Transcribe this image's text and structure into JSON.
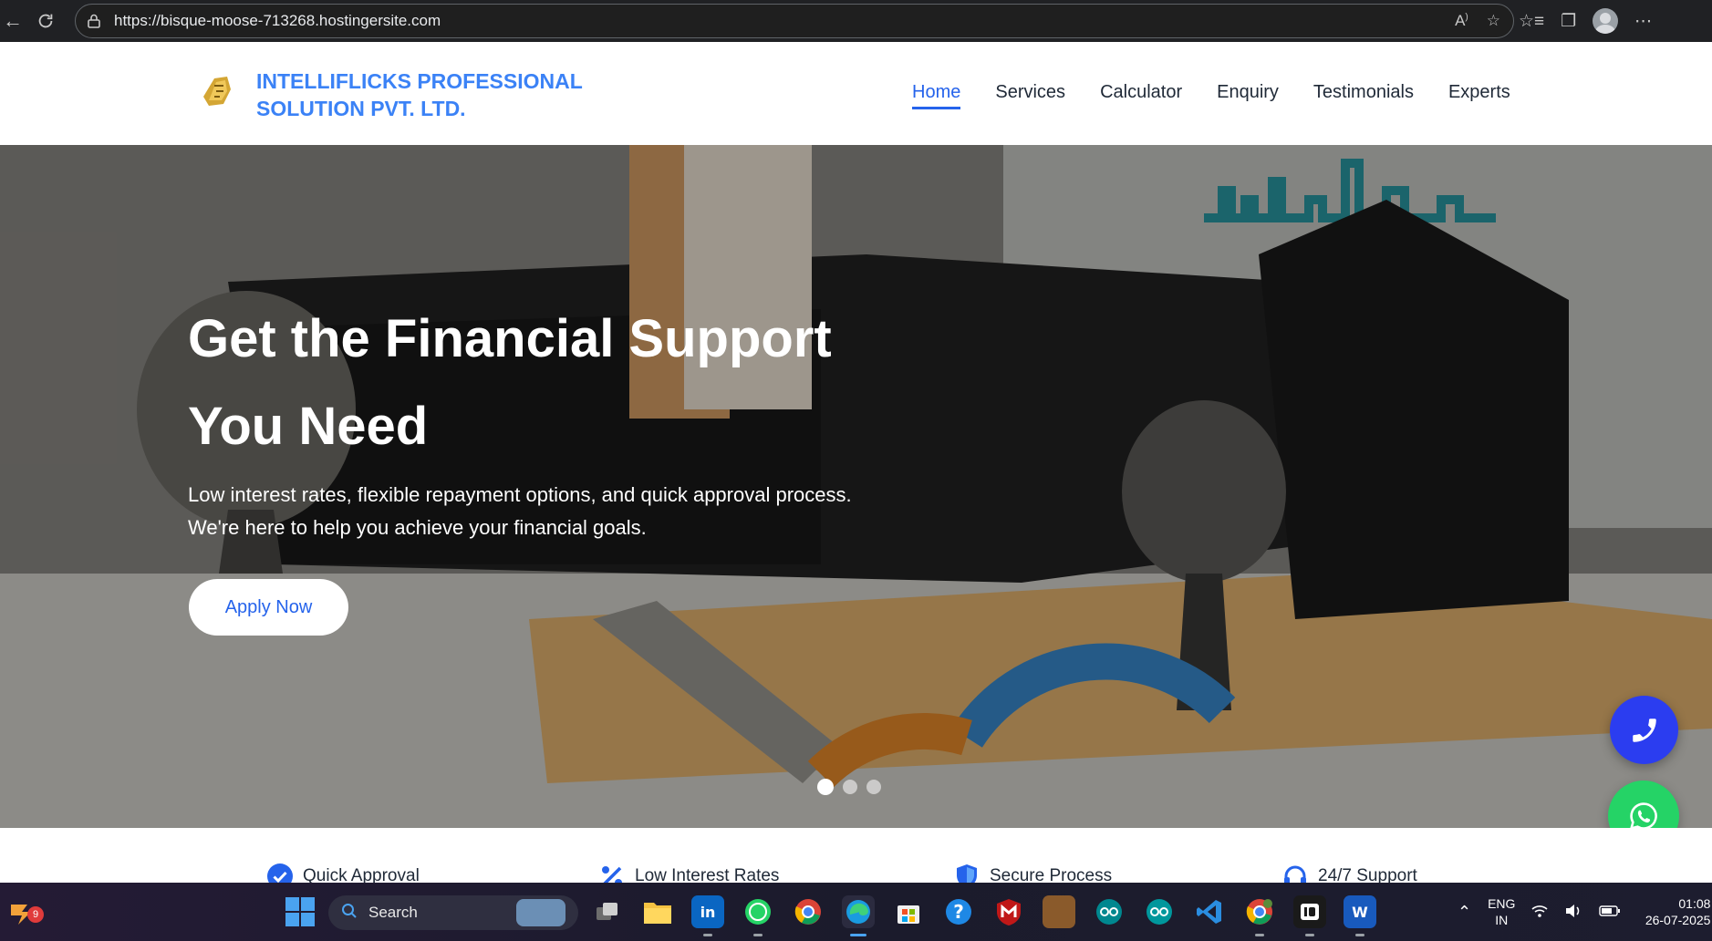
{
  "browser": {
    "url": "https://bisque-moose-713268.hostingersite.com",
    "icons": [
      "back-icon",
      "refresh-icon",
      "lock-icon",
      "read-aloud-icon",
      "favorite-star-icon",
      "favorites-icon",
      "extensions-icon",
      "profile-icon",
      "more-icon"
    ]
  },
  "header": {
    "brand": "INTELLIFLICKS PROFESSIONAL SOLUTION PVT. LTD.",
    "menu": [
      {
        "label": "Home",
        "active": true
      },
      {
        "label": "Services"
      },
      {
        "label": "Calculator"
      },
      {
        "label": "Enquiry"
      },
      {
        "label": "Testimonials"
      },
      {
        "label": "Experts"
      }
    ]
  },
  "hero": {
    "title_line1": "Get the Financial Support",
    "title_line2": "You Need",
    "subtitle_line1": "Low interest rates, flexible repayment options, and quick approval process.",
    "subtitle_line2": "We're here to help you achieve your financial goals.",
    "cta": "Apply Now",
    "slides": 3,
    "active_slide": 1
  },
  "features": [
    {
      "label": "Quick Approval",
      "icon": "check-badge-icon"
    },
    {
      "label": "Low Interest Rates",
      "icon": "percent-icon"
    },
    {
      "label": "Secure Process",
      "icon": "shield-icon"
    },
    {
      "label": "24/7 Support",
      "icon": "headset-icon"
    }
  ],
  "floating": {
    "call_icon": "phone-icon",
    "whatsapp_icon": "whatsapp-icon"
  },
  "taskbar": {
    "widget_badge": "9",
    "search_placeholder": "Search",
    "language_line1": "ENG",
    "language_line2": "IN",
    "time": "01:08",
    "date": "26-07-2025"
  },
  "colors": {
    "accent": "#3b82f6",
    "nav_active": "#2563eb",
    "call_button": "#2b3df0",
    "whatsapp": "#25d366"
  }
}
